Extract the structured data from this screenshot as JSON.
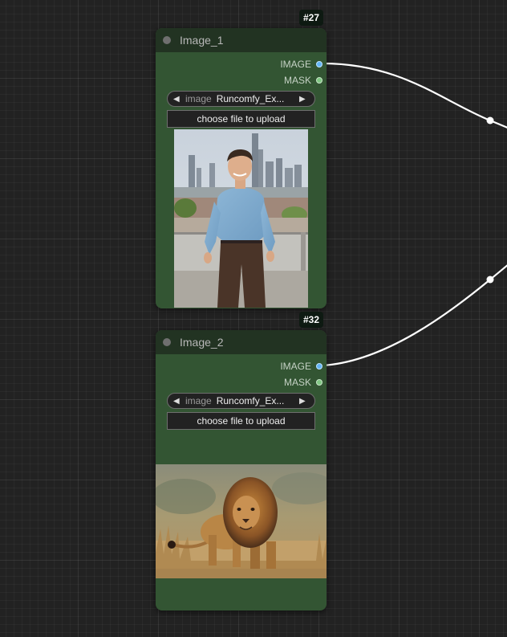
{
  "graph": {
    "nodes": [
      {
        "id_badge": "#27",
        "title": "Image_1",
        "outputs": [
          "IMAGE",
          "MASK"
        ],
        "combo": {
          "name": "image",
          "value": "Runcomfy_Ex..."
        },
        "upload_label": "choose file to upload",
        "preview": "man-city-rooftop-photo"
      },
      {
        "id_badge": "#32",
        "title": "Image_2",
        "outputs": [
          "IMAGE",
          "MASK"
        ],
        "combo": {
          "name": "image",
          "value": "Runcomfy_Ex..."
        },
        "upload_label": "choose file to upload",
        "preview": "lion-photo"
      }
    ],
    "colors": {
      "canvas": "#222222",
      "node_body": "#335533",
      "node_title": "#223322",
      "image_slot": "#64b5f6",
      "mask_slot": "#81c784",
      "link": "#ffffff"
    }
  }
}
